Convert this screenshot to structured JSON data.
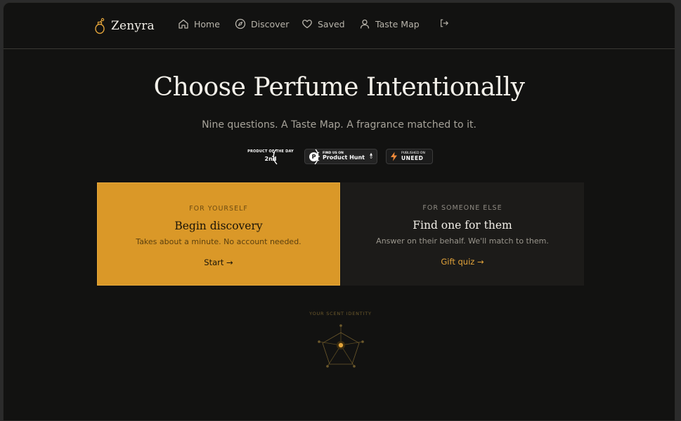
{
  "brand": {
    "name": "Zenyra",
    "accent": "#da9828"
  },
  "nav": {
    "items": [
      {
        "label": "Home",
        "icon": "home-icon"
      },
      {
        "label": "Discover",
        "icon": "compass-icon"
      },
      {
        "label": "Saved",
        "icon": "heart-icon"
      },
      {
        "label": "Taste Map",
        "icon": "user-icon"
      }
    ],
    "logout_icon": "logout-icon"
  },
  "hero": {
    "title": "Choose Perfume Intentionally",
    "subtitle": "Nine questions. A Taste Map. A fragrance matched to it."
  },
  "badges": {
    "potd": {
      "line1": "PRODUCT OF THE DAY",
      "line2": "2nd"
    },
    "product_hunt": {
      "small": "FIND US ON",
      "big": "Product Hunt",
      "votes": "0"
    },
    "uneed": {
      "small": "PUBLISHED ON",
      "big": "UNEED"
    }
  },
  "cards": {
    "self": {
      "eyebrow": "FOR YOURSELF",
      "title": "Begin discovery",
      "desc": "Takes about a minute. No account needed.",
      "cta": "Start →"
    },
    "other": {
      "eyebrow": "FOR SOMEONE ELSE",
      "title": "Find one for them",
      "desc": "Answer on their behalf. We'll match to them.",
      "cta": "Gift quiz →"
    }
  },
  "scent": {
    "label": "YOUR SCENT IDENTITY"
  }
}
